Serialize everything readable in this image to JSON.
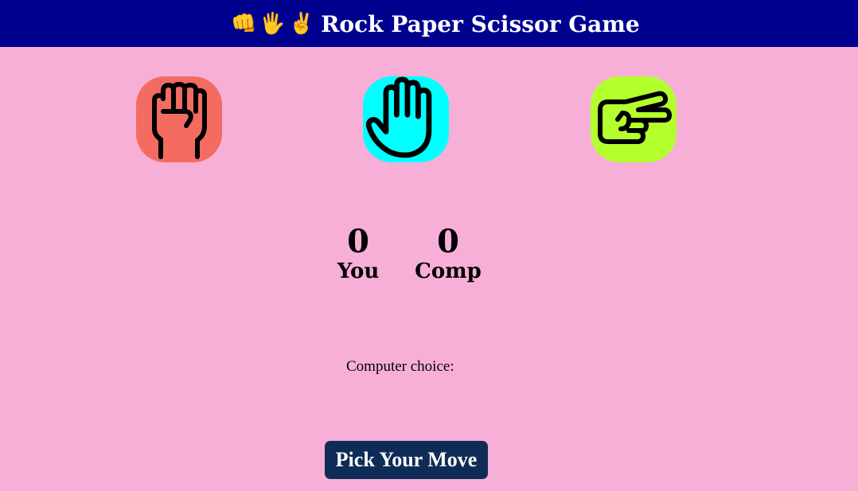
{
  "header": {
    "emojis": [
      "👊",
      "🖐",
      "✌"
    ],
    "title": "Rock Paper Scissor Game",
    "background": "#00008f"
  },
  "choices": [
    {
      "name": "rock",
      "icon": "fist-icon",
      "background": "#f36b61"
    },
    {
      "name": "paper",
      "icon": "open-hand-icon",
      "background": "#00ffff"
    },
    {
      "name": "scissor",
      "icon": "scissors-hand-icon",
      "background": "#b4ff2e"
    }
  ],
  "scoreboard": {
    "you": {
      "score": "0",
      "label": "You"
    },
    "comp": {
      "score": "0",
      "label": "Comp"
    }
  },
  "result": {
    "computer_choice_label": "Computer choice:"
  },
  "action": {
    "pick_label": "Pick Your Move",
    "background": "#0e2c56"
  },
  "page": {
    "background": "#f7afd8"
  }
}
